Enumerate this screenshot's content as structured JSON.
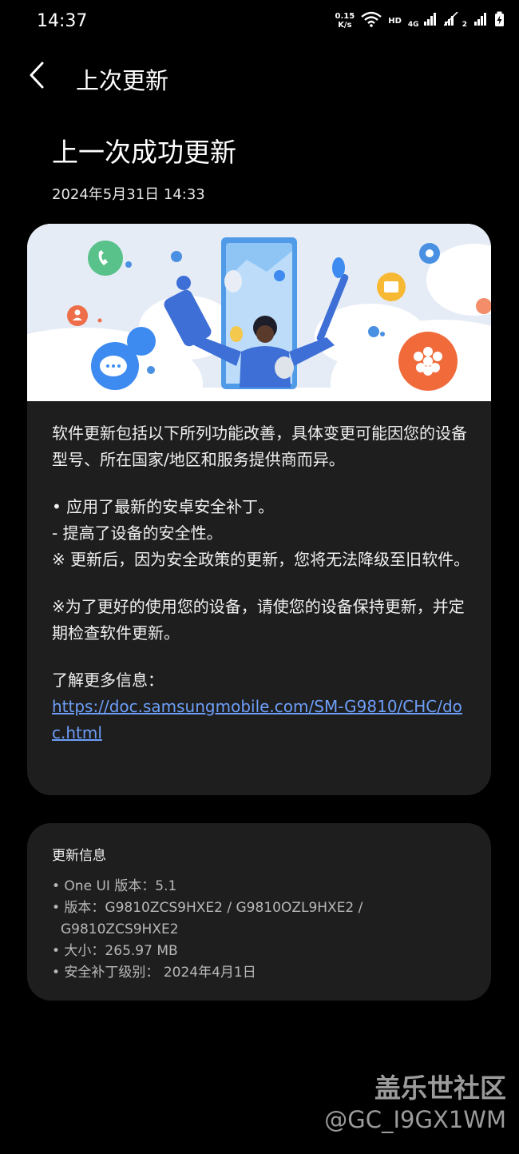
{
  "status_bar": {
    "time": "14:37",
    "net_speed_value": "0.15",
    "net_speed_unit": "K/s",
    "hd_label": "HD",
    "network_label": "4G",
    "sim2_label": "2",
    "icons": [
      "wifi-icon",
      "signal-icon",
      "signal-icon",
      "battery-charging-icon"
    ]
  },
  "app_bar": {
    "back_icon": "chevron-left-icon",
    "title": "上次更新"
  },
  "page": {
    "title": "上一次成功更新",
    "date": "2024年5月31日 14:33"
  },
  "release_notes": {
    "intro": "软件更新包括以下所列功能改善，具体变更可能因您的设备型号、所在国家/地区和服务提供商而异。",
    "item1": "• 应用了最新的安卓安全补丁。",
    "item2": " - 提高了设备的安全性。",
    "item3": "※ 更新后，因为安全政策的更新，您将无法降级至旧软件。",
    "notice": "※为了更好的使用您的设备，请使您的设备保持更新，并定期检查软件更新。",
    "more_info_label": "了解更多信息：",
    "link": "https://doc.samsungmobile.com/SM-G9810/CHC/doc.html"
  },
  "update_info": {
    "heading": "更新信息",
    "one_ui": "• One UI 版本：5.1",
    "version_line1": "• 版本：G9810ZCS9HXE2 / G9810OZL9HXE2 /",
    "version_line2": "G9810ZCS9HXE2",
    "size": "• 大小：265.97 MB",
    "security_patch": "• 安全补丁级别： 2024年4月1日"
  },
  "watermark": {
    "title": "盖乐世社区",
    "user": "@GC_I9GX1WM"
  },
  "colors": {
    "background": "#000000",
    "card": "#1e1e1e",
    "link": "#6d9ef8",
    "illustration_bg": "#e6ecf6"
  }
}
